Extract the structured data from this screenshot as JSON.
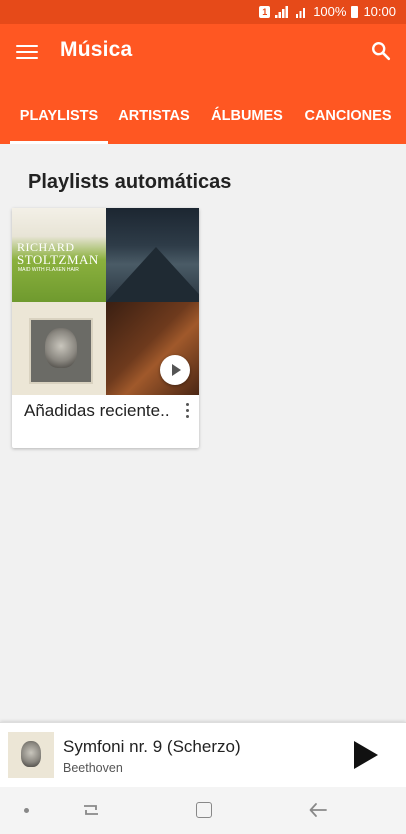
{
  "status_bar": {
    "sim_label": "1",
    "battery_text": "100%",
    "time": "10:00"
  },
  "app_bar": {
    "title": "Música",
    "menu_icon": "hamburger-menu-icon",
    "search_icon": "search-icon",
    "color": "#ff5722"
  },
  "tabs": [
    {
      "label": "PLAYLISTS",
      "active": true
    },
    {
      "label": "ARTISTAS",
      "active": false
    },
    {
      "label": "ÁLBUMES",
      "active": false
    },
    {
      "label": "CANCIONES",
      "active": false
    }
  ],
  "section": {
    "title": "Playlists automáticas"
  },
  "playlist_card": {
    "title": "Añadidas reciente..",
    "cover_art": {
      "art1_line1": "RICHARD",
      "art1_line2": "STOLTZMAN",
      "art1_line3": "MAID WITH FLAXEN HAIR"
    }
  },
  "now_playing": {
    "title": "Symfoni nr. 9 (Scherzo)",
    "artist": "Beethoven"
  }
}
